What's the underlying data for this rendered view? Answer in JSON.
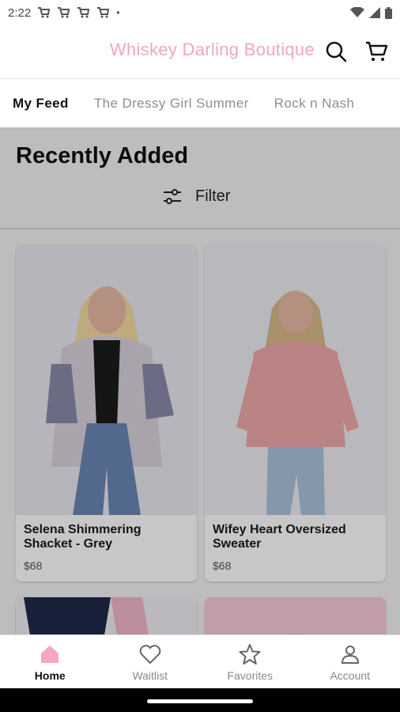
{
  "status_bar": {
    "time": "2:22",
    "dot": "•"
  },
  "header": {
    "brand": "Whiskey Darling Boutique",
    "brand_color": "#f1a6c2"
  },
  "tabs": [
    {
      "label": "My Feed",
      "active": true
    },
    {
      "label": "The Dressy Girl Summer",
      "active": false
    },
    {
      "label": "Rock n Nash",
      "active": false
    }
  ],
  "feed": {
    "title": "Recently Added",
    "filter_label": "Filter",
    "products": [
      {
        "name": "Selena Shimmering Shacket - Grey",
        "price": "$68"
      },
      {
        "name": "Wifey Heart Oversized Sweater",
        "price": "$68"
      }
    ]
  },
  "bottom_nav": [
    {
      "label": "Home",
      "icon": "home-icon",
      "active": true
    },
    {
      "label": "Waitlist",
      "icon": "heart-icon",
      "active": false
    },
    {
      "label": "Favorites",
      "icon": "star-icon",
      "active": false
    },
    {
      "label": "Account",
      "icon": "person-icon",
      "active": false
    }
  ],
  "colors": {
    "accent_pink": "#f7c3d6",
    "home_icon_pink": "#f4a7c3"
  }
}
